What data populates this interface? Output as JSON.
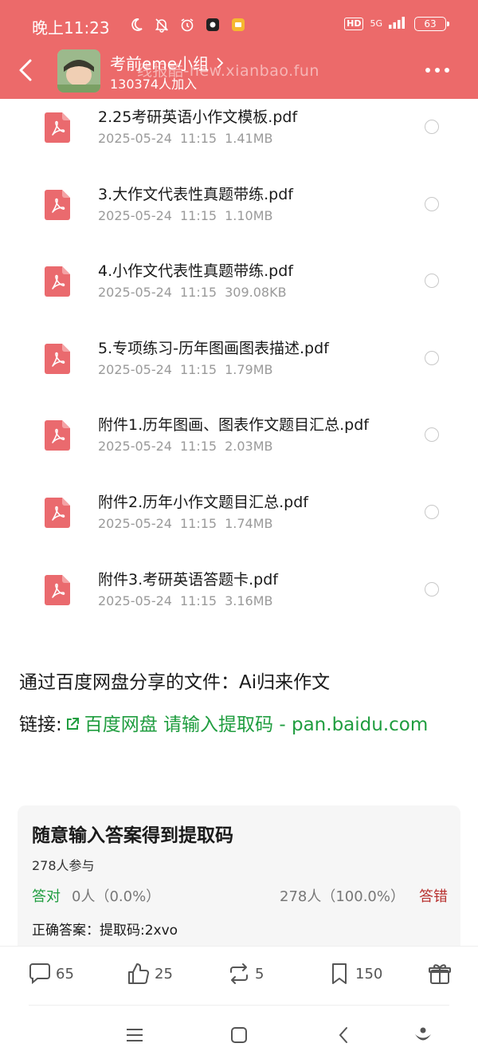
{
  "status_bar": {
    "time": "晚上11:23",
    "hd_badge": "HD",
    "network": "5G",
    "battery": "63"
  },
  "header": {
    "group_name": "考前eme小组",
    "members": "130374人加入",
    "watermark": "线报酷-new.xianbao.fun"
  },
  "files": [
    {
      "name": "2.25考研英语小作文模板.pdf",
      "date": "2025-05-24",
      "time": "11:15",
      "size": "1.41MB"
    },
    {
      "name": "3.大作文代表性真题带练.pdf",
      "date": "2025-05-24",
      "time": "11:15",
      "size": "1.10MB"
    },
    {
      "name": "4.小作文代表性真题带练.pdf",
      "date": "2025-05-24",
      "time": "11:15",
      "size": "309.08KB"
    },
    {
      "name": "5.专项练习-历年图画图表描述.pdf",
      "date": "2025-05-24",
      "time": "11:15",
      "size": "1.79MB"
    },
    {
      "name": "附件1.历年图画、图表作文题目汇总.pdf",
      "date": "2025-05-24",
      "time": "11:15",
      "size": "2.03MB"
    },
    {
      "name": "附件2.历年小作文题目汇总.pdf",
      "date": "2025-05-24",
      "time": "11:15",
      "size": "1.74MB"
    },
    {
      "name": "附件3.考研英语答题卡.pdf",
      "date": "2025-05-24",
      "time": "11:15",
      "size": "3.16MB"
    }
  ],
  "post": {
    "share_text": "通过百度网盘分享的文件：Ai归来作文",
    "link_prefix": "链接:",
    "link_text": "百度网盘 请输入提取码 - pan.baidu.com"
  },
  "quiz": {
    "title": "随意输入答案得到提取码",
    "participants": "278人参与",
    "correct_label": "答对",
    "correct_value": "0人（0.0%）",
    "wrong_value": "278人（100.0%）",
    "wrong_label": "答错",
    "answer": "正确答案：提取码:2xvo"
  },
  "actions": {
    "comments": "65",
    "likes": "25",
    "reposts": "5",
    "bookmarks": "150"
  },
  "colors": {
    "header_bg": "#ec6a6a",
    "pdf_icon": "#ea6a6e",
    "link_green": "#1f9d3f",
    "wrong_red": "#b8312f"
  }
}
